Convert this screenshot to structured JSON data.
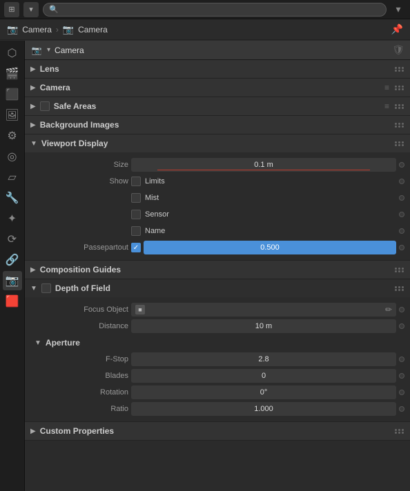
{
  "topbar": {
    "icon_label": "☰",
    "search_placeholder": "",
    "dropdown_icon": "▾"
  },
  "breadcrumb": {
    "item1_icon": "📷",
    "item1_label": "Camera",
    "item2_icon": "📷",
    "item2_label": "Camera",
    "pin_icon": "📌"
  },
  "sidebar": {
    "icons": [
      {
        "name": "scene-icon",
        "glyph": "⬡",
        "active": false
      },
      {
        "name": "render-icon",
        "glyph": "🎬",
        "active": false
      },
      {
        "name": "output-icon",
        "glyph": "⬛",
        "active": false
      },
      {
        "name": "view-layer-icon",
        "glyph": "🖼",
        "active": false
      },
      {
        "name": "scene-props-icon",
        "glyph": "⚙",
        "active": false
      },
      {
        "name": "world-icon",
        "glyph": "◎",
        "active": false
      },
      {
        "name": "object-icon",
        "glyph": "▱",
        "active": false
      },
      {
        "name": "modifier-icon",
        "glyph": "🔧",
        "active": false
      },
      {
        "name": "particles-icon",
        "glyph": "✦",
        "active": false
      },
      {
        "name": "physics-icon",
        "glyph": "⟳",
        "active": false
      },
      {
        "name": "constraints-icon",
        "glyph": "🔗",
        "active": false
      },
      {
        "name": "data-icon",
        "glyph": "📷",
        "active": true
      },
      {
        "name": "material-icon",
        "glyph": "🟥",
        "active": false
      }
    ]
  },
  "object_header": {
    "icon": "📷",
    "name": "Camera",
    "shield_icon": "🛡"
  },
  "sections": {
    "lens": {
      "label": "Lens",
      "collapsed": true
    },
    "camera": {
      "label": "Camera",
      "collapsed": true
    },
    "safe_areas": {
      "label": "Safe Areas",
      "collapsed": true
    },
    "background_images": {
      "label": "Background Images",
      "collapsed": true
    },
    "viewport_display": {
      "label": "Viewport Display",
      "collapsed": false,
      "size_label": "Size",
      "size_value": "0.1 m",
      "show_label": "Show",
      "limits_label": "Limits",
      "mist_label": "Mist",
      "sensor_label": "Sensor",
      "name_label": "Name",
      "passepartout_label": "Passepartout",
      "passepartout_value": "0.500"
    },
    "composition_guides": {
      "label": "Composition Guides",
      "collapsed": true
    },
    "depth_of_field": {
      "label": "Depth of Field",
      "collapsed": false,
      "focus_object_label": "Focus Object",
      "distance_label": "Distance",
      "distance_value": "10 m",
      "aperture": {
        "label": "Aperture",
        "fstop_label": "F-Stop",
        "fstop_value": "2.8",
        "blades_label": "Blades",
        "blades_value": "0",
        "rotation_label": "Rotation",
        "rotation_value": "0°",
        "ratio_label": "Ratio",
        "ratio_value": "1.000"
      }
    },
    "custom_properties": {
      "label": "Custom Properties",
      "collapsed": true
    }
  }
}
